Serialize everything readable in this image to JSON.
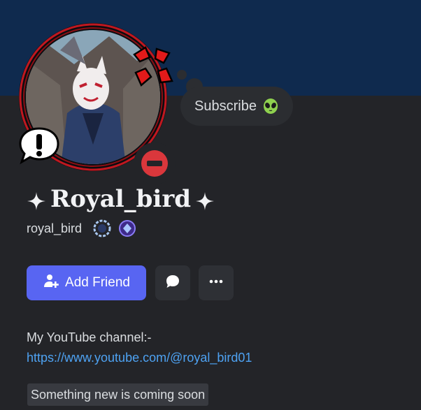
{
  "profile": {
    "display_name": "Royal_bird",
    "username": "royal_bird",
    "status_text": "Subscribe",
    "status_emoji": "alien-face-icon",
    "presence": "do-not-disturb",
    "badges": [
      "hypesquad-balance-icon",
      "quest-badge-icon"
    ]
  },
  "actions": {
    "add_friend_label": "Add Friend",
    "message_icon": "message-bubble-icon",
    "more_icon": "more-dots-icon"
  },
  "about": {
    "line1": "My YouTube channel:-",
    "link": "https://www.youtube.com/@royal_bird01",
    "highlight": "Something new is coming soon"
  },
  "colors": {
    "banner": "#0f2a4e",
    "background": "#232428",
    "accent": "#5865f2",
    "link": "#4ea2f2",
    "dnd": "#da373c"
  }
}
